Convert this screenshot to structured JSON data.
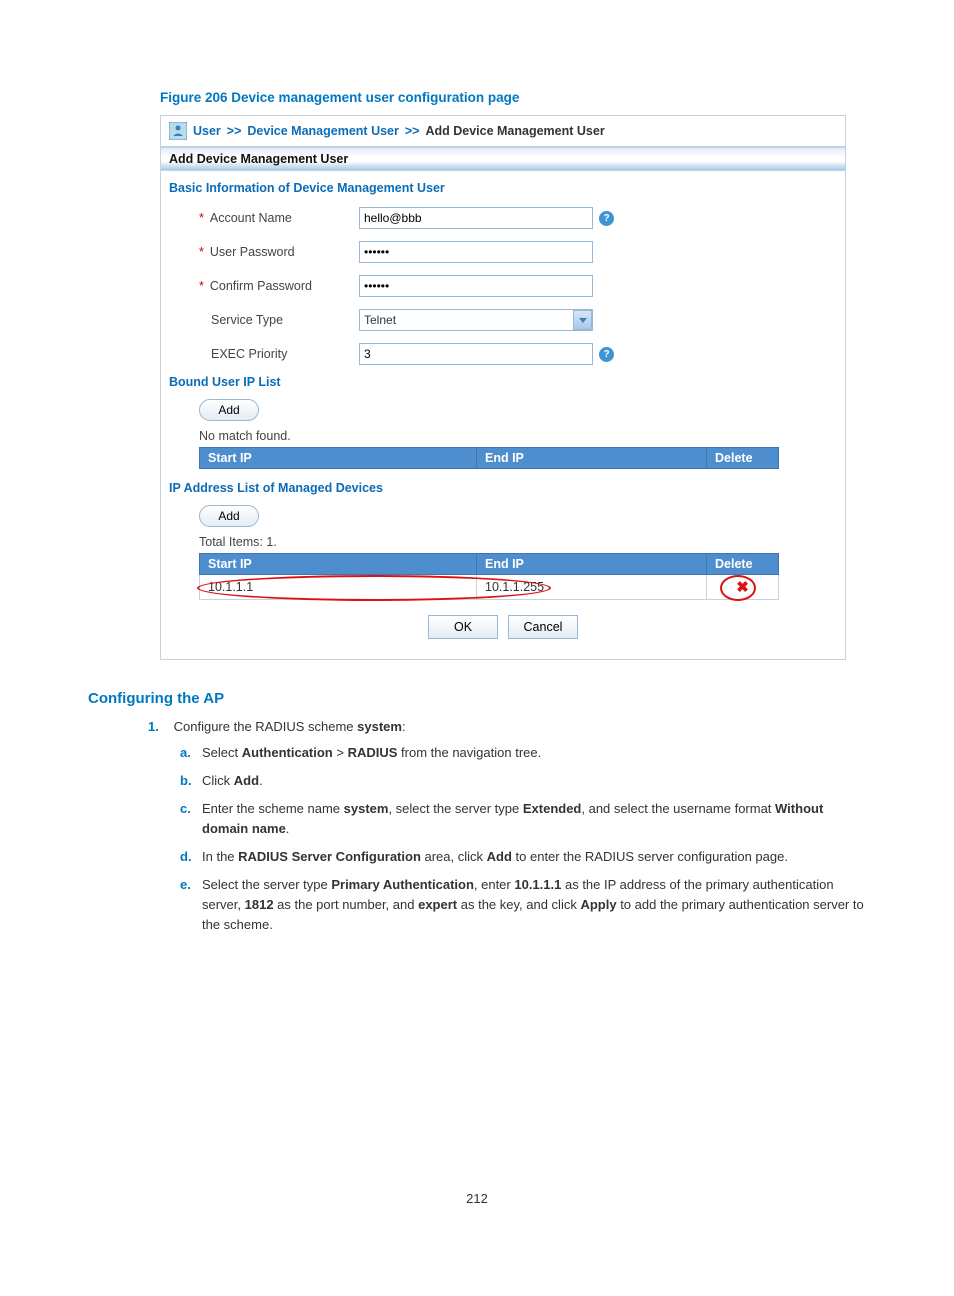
{
  "figure_caption": "Figure 206 Device management user configuration page",
  "breadcrumb": {
    "link1": "User",
    "sep": ">>",
    "link2": "Device Management User",
    "current": "Add Device Management User"
  },
  "section_bar_title": "Add Device Management User",
  "basic_info_title": "Basic Information of Device Management User",
  "form": {
    "account_name_label": "Account Name",
    "account_name_value": "hello@bbb",
    "user_password_label": "User Password",
    "user_password_value": "••••••",
    "confirm_password_label": "Confirm Password",
    "confirm_password_value": "••••••",
    "service_type_label": "Service Type",
    "service_type_value": "Telnet",
    "exec_priority_label": "EXEC Priority",
    "exec_priority_value": "3"
  },
  "bound_ip": {
    "title": "Bound User IP List",
    "add_label": "Add",
    "empty_msg": "No match found.",
    "col_start": "Start IP",
    "col_end": "End IP",
    "col_delete": "Delete"
  },
  "managed_ip": {
    "title": "IP Address List of Managed Devices",
    "add_label": "Add",
    "total_msg": "Total Items: 1.",
    "col_start": "Start IP",
    "col_end": "End IP",
    "col_delete": "Delete",
    "row": {
      "start": "10.1.1.1",
      "end": "10.1.1.255"
    }
  },
  "buttons": {
    "ok": "OK",
    "cancel": "Cancel"
  },
  "doc": {
    "heading": "Configuring the AP",
    "step1_pre": "Configure the RADIUS scheme ",
    "step1_bold": "system",
    "a_pre": "Select ",
    "a_b1": "Authentication",
    "a_mid": " > ",
    "a_b2": "RADIUS",
    "a_post": " from the navigation tree.",
    "b_pre": "Click ",
    "b_b1": "Add",
    "b_post": ".",
    "c_pre": "Enter the scheme name ",
    "c_b1": "system",
    "c_mid1": ", select the server type ",
    "c_b2": "Extended",
    "c_mid2": ", and select the username format ",
    "c_b3": "Without domain name",
    "c_post": ".",
    "d_pre": "In the ",
    "d_b1": "RADIUS Server Configuration",
    "d_mid1": " area, click ",
    "d_b2": "Add",
    "d_post": " to enter the RADIUS server configuration page.",
    "e_pre": "Select the server type ",
    "e_b1": "Primary Authentication",
    "e_mid1": ", enter ",
    "e_b2": "10.1.1.1",
    "e_mid2": " as the IP address of the primary authentication server, ",
    "e_b3": "1812",
    "e_mid3": " as the port number, and ",
    "e_b4": "expert",
    "e_mid4": " as the key, and click ",
    "e_b5": "Apply",
    "e_post": " to add the primary authentication server to the scheme."
  },
  "page_number": "212"
}
